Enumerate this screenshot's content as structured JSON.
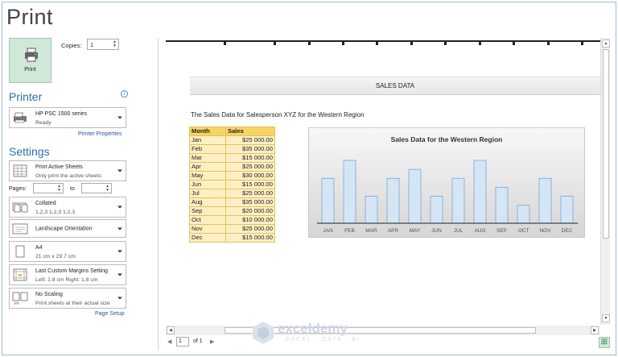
{
  "page_title": "Print",
  "print_button": {
    "label": "Print",
    "icon": "printer-icon"
  },
  "copies": {
    "label": "Copies:",
    "value": "1"
  },
  "printer": {
    "heading": "Printer",
    "info_icon": "info-icon",
    "name": "HP PSC 1500 series",
    "status": "Ready",
    "properties_link": "Printer Properties"
  },
  "settings": {
    "heading": "Settings",
    "what_to_print": {
      "line1": "Print Active Sheets",
      "line2": "Only print the active sheets"
    },
    "pages": {
      "label": "Pages:",
      "from_value": "",
      "to_label": "to",
      "to_value": ""
    },
    "collation": {
      "line1": "Collated",
      "line2": "1,2,3    1,2,3    1,2,3"
    },
    "orientation": {
      "line1": "Landscape Orientation"
    },
    "paper": {
      "line1": "A4",
      "line2": "21 cm x 29.7 cm"
    },
    "margins": {
      "line1": "Last Custom Margins Setting",
      "line2": "Left: 1.8 cm   Right: 1.8 cm"
    },
    "scaling": {
      "line1": "No Scaling",
      "line2": "Print sheets at their actual size"
    },
    "page_setup_link": "Page Setup"
  },
  "preview": {
    "header_text": "SALES DATA",
    "subtitle": "The Sales Data for Salesperson XYZ for the Western Region",
    "table": {
      "headers": [
        "Month",
        "Sales"
      ],
      "rows": [
        [
          "Jan",
          "$25 000.00"
        ],
        [
          "Feb",
          "$35 000.00"
        ],
        [
          "Mar",
          "$15 000.00"
        ],
        [
          "Apr",
          "$25 000.00"
        ],
        [
          "May",
          "$30 000.00"
        ],
        [
          "Jun",
          "$15 000.00"
        ],
        [
          "Jul",
          "$25 000.00"
        ],
        [
          "Aug",
          "$35 000.00"
        ],
        [
          "Sep",
          "$20 000.00"
        ],
        [
          "Oct",
          "$10 000.00"
        ],
        [
          "Nov",
          "$25 000.00"
        ],
        [
          "Dec",
          "$15 000.00"
        ]
      ]
    }
  },
  "chart_data": {
    "type": "bar",
    "title": "Sales Data for the Western Region",
    "categories": [
      "JAN",
      "FEB",
      "MAR",
      "APR",
      "MAY",
      "JUN",
      "JUL",
      "AUG",
      "SEP",
      "OCT",
      "NOV",
      "DEC"
    ],
    "values": [
      25000,
      35000,
      15000,
      25000,
      30000,
      15000,
      25000,
      35000,
      20000,
      10000,
      25000,
      15000
    ],
    "ylim": [
      0,
      35000
    ],
    "grid": false,
    "legend": "none",
    "bar_color": "#d4e6f5"
  },
  "pager": {
    "current_page": "1",
    "of_text": "of 1"
  },
  "watermark": {
    "brand": "exceldemy",
    "tagline": "EXCEL · DATA · BI"
  },
  "colors": {
    "accent": "#2e6da4",
    "print_button": "#cfe8d8",
    "table_header": "#f7d463",
    "table_cell": "#fcefc3"
  }
}
